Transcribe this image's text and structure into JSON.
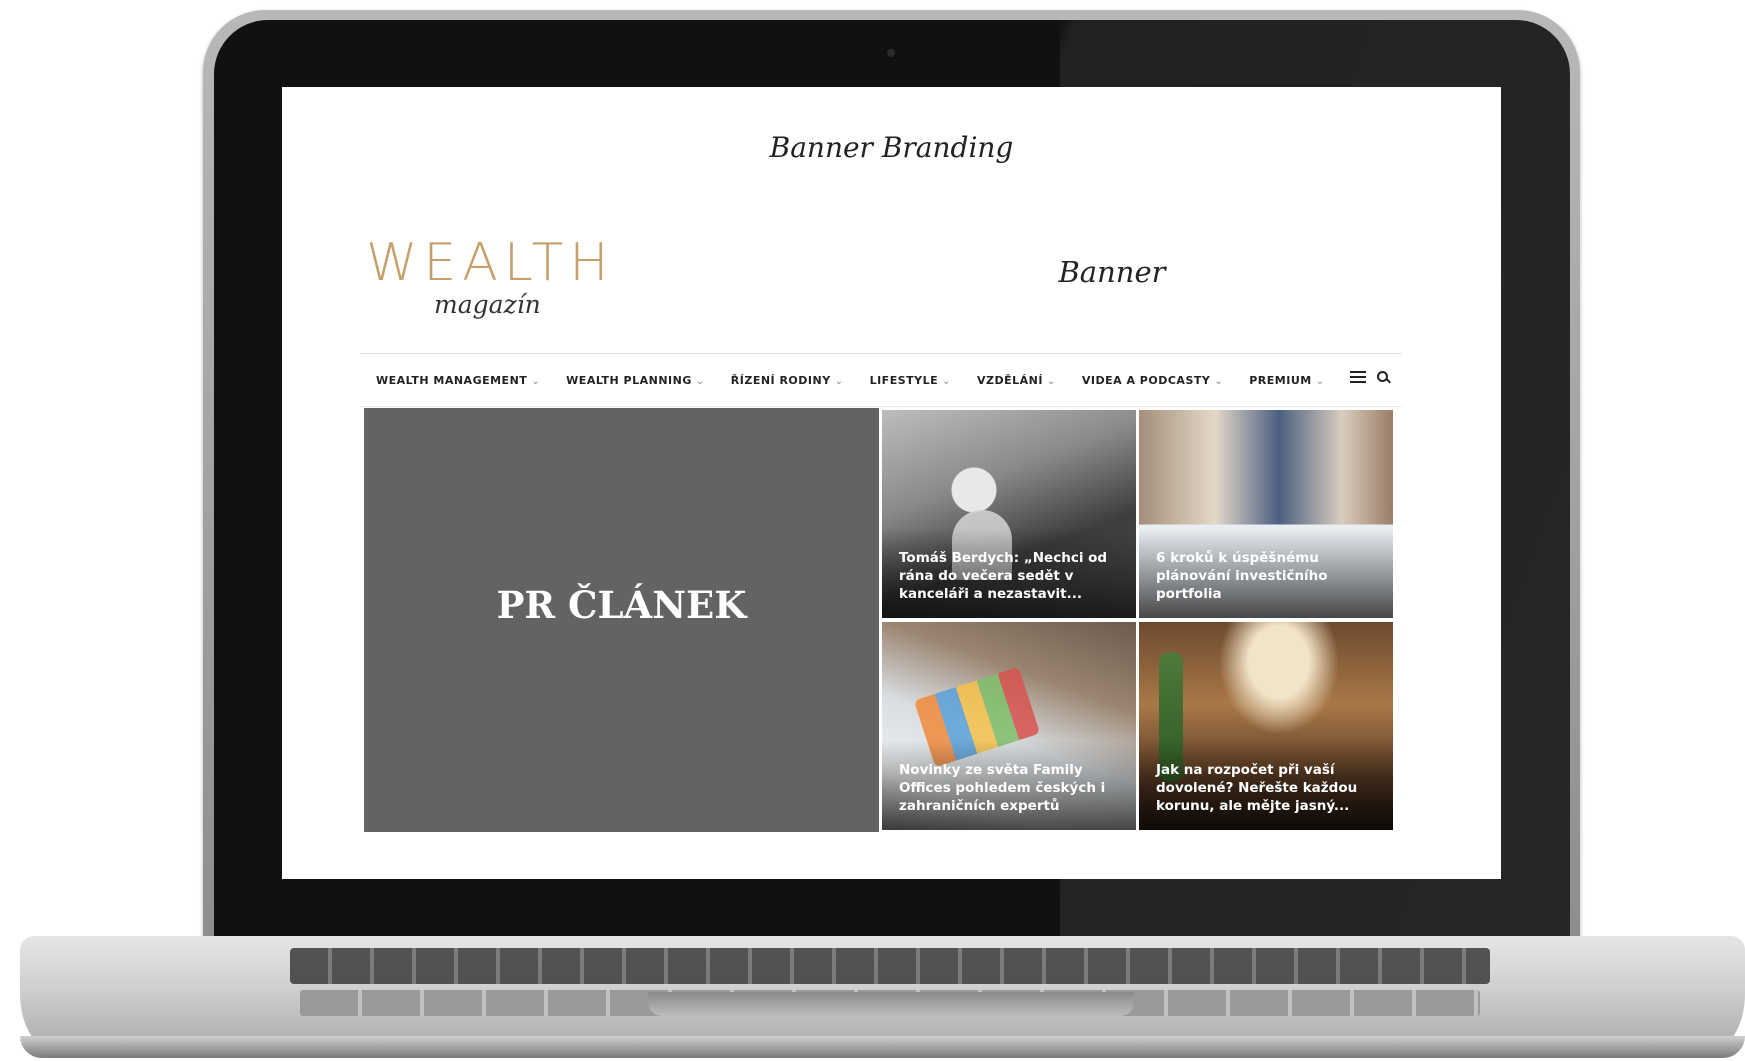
{
  "screen": {
    "banner_branding": "Banner Branding",
    "banner": "Banner",
    "logo": {
      "main": "WEALTH",
      "sub": "magazín"
    },
    "nav": {
      "items": [
        "WEALTH MANAGEMENT",
        "WEALTH PLANNING",
        "ŘÍZENÍ RODINY",
        "LIFESTYLE",
        "VZDĚLÁNÍ",
        "VIDEA A PODCASTY",
        "PREMIUM"
      ],
      "chevron": "⌄"
    },
    "pr_block": "PR ČLÁNEK",
    "articles": [
      {
        "title": "Tomáš Berdych: „Nechci od rána do večera sedět v kanceláři a nezastavit..."
      },
      {
        "title": "6 kroků k úspěšnému plánování investičního portfolia"
      },
      {
        "title": "Novinky ze světa Family Offices pohledem českých i zahraničních expertů"
      },
      {
        "title": "Jak na rozpočet při vaší dovolené? Neřešte každou korunu, ale mějte jasný..."
      }
    ]
  },
  "colors": {
    "logo_gold": "#c5a06b",
    "pr_block_bg": "#636363"
  }
}
